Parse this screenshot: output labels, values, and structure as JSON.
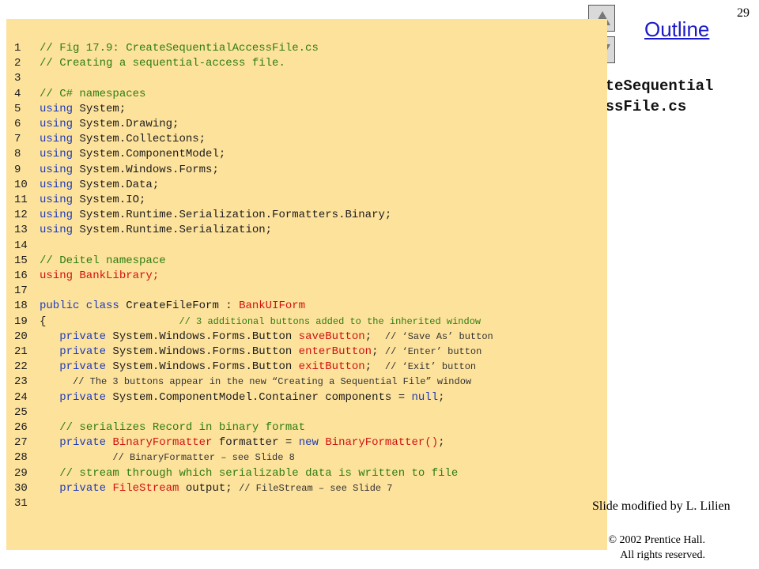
{
  "page_number": "29",
  "outline_title": "Outline",
  "file_label_line1": "CreateSequential",
  "file_label_line2": "AccessFile.cs",
  "slide_modified": "Slide modified by L. Lilien",
  "copyright_line1": "© 2002 Prentice Hall.",
  "copyright_line2": "All rights reserved.",
  "nav": {
    "up_icon": "triangle-up-icon",
    "down_icon": "triangle-down-icon"
  },
  "colors": {
    "panel_bg": "#fde29c",
    "comment": "#2e7d11",
    "keyword": "#1e3bb8",
    "highlight": "#d11111",
    "outline_link": "#1a1ac8"
  },
  "code_lines": [
    {
      "n": "1",
      "indent": "",
      "segments": [
        {
          "c": "cmt",
          "t": "// Fig 17.9: CreateSequentialAccessFile.cs"
        }
      ]
    },
    {
      "n": "2",
      "indent": "",
      "segments": [
        {
          "c": "cmt",
          "t": "// Creating a sequential-access file."
        }
      ]
    },
    {
      "n": "3",
      "indent": "",
      "segments": []
    },
    {
      "n": "4",
      "indent": "",
      "segments": [
        {
          "c": "cmt",
          "t": "// C# namespaces"
        }
      ]
    },
    {
      "n": "5",
      "indent": "",
      "segments": [
        {
          "c": "kw",
          "t": "using"
        },
        {
          "c": "",
          "t": " System;"
        }
      ]
    },
    {
      "n": "6",
      "indent": "",
      "segments": [
        {
          "c": "kw",
          "t": "using"
        },
        {
          "c": "",
          "t": " System.Drawing;"
        }
      ]
    },
    {
      "n": "7",
      "indent": "",
      "segments": [
        {
          "c": "kw",
          "t": "using"
        },
        {
          "c": "",
          "t": " System.Collections;"
        }
      ]
    },
    {
      "n": "8",
      "indent": "",
      "segments": [
        {
          "c": "kw",
          "t": "using"
        },
        {
          "c": "",
          "t": " System.ComponentModel;"
        }
      ]
    },
    {
      "n": "9",
      "indent": "",
      "segments": [
        {
          "c": "kw",
          "t": "using"
        },
        {
          "c": "",
          "t": " System.Windows.Forms;"
        }
      ]
    },
    {
      "n": "10",
      "indent": "",
      "segments": [
        {
          "c": "kw",
          "t": "using"
        },
        {
          "c": "",
          "t": " System.Data;"
        }
      ]
    },
    {
      "n": "11",
      "indent": "",
      "segments": [
        {
          "c": "kw",
          "t": "using"
        },
        {
          "c": "",
          "t": " System.IO;"
        }
      ]
    },
    {
      "n": "12",
      "indent": "",
      "segments": [
        {
          "c": "kw",
          "t": "using"
        },
        {
          "c": "",
          "t": " System.Runtime.Serialization.Formatters.Binary;"
        }
      ]
    },
    {
      "n": "13",
      "indent": "",
      "segments": [
        {
          "c": "kw",
          "t": "using"
        },
        {
          "c": "",
          "t": " System.Runtime.Serialization;"
        }
      ]
    },
    {
      "n": "14",
      "indent": "",
      "segments": []
    },
    {
      "n": "15",
      "indent": "",
      "segments": [
        {
          "c": "cmt",
          "t": "// Deitel namespace"
        }
      ]
    },
    {
      "n": "16",
      "indent": "",
      "segments": [
        {
          "c": "red",
          "t": "using BankLibrary;"
        }
      ]
    },
    {
      "n": "17",
      "indent": "",
      "segments": []
    },
    {
      "n": "18",
      "indent": "",
      "segments": [
        {
          "c": "kw",
          "t": "public class"
        },
        {
          "c": "",
          "t": " CreateFileForm : "
        },
        {
          "c": "red",
          "t": "BankUIForm"
        }
      ]
    },
    {
      "n": "19",
      "indent": "",
      "segments": [
        {
          "c": "",
          "t": "{                    "
        },
        {
          "c": "cmt-small",
          "t": "// 3 additional buttons added to the inherited window"
        }
      ]
    },
    {
      "n": "20",
      "indent": "   ",
      "segments": [
        {
          "c": "kw",
          "t": "private"
        },
        {
          "c": "",
          "t": " System.Windows.Forms.Button "
        },
        {
          "c": "red",
          "t": "saveButton"
        },
        {
          "c": "",
          "t": ";  "
        },
        {
          "c": "cmt-black",
          "t": "// ‘Save As’ button"
        }
      ]
    },
    {
      "n": "21",
      "indent": "   ",
      "segments": [
        {
          "c": "kw",
          "t": "private"
        },
        {
          "c": "",
          "t": " System.Windows.Forms.Button "
        },
        {
          "c": "red",
          "t": "enterButton"
        },
        {
          "c": "",
          "t": "; "
        },
        {
          "c": "cmt-black",
          "t": "// ‘Enter’ button"
        }
      ]
    },
    {
      "n": "22",
      "indent": "   ",
      "segments": [
        {
          "c": "kw",
          "t": "private"
        },
        {
          "c": "",
          "t": " System.Windows.Forms.Button "
        },
        {
          "c": "red",
          "t": "exitButton"
        },
        {
          "c": "",
          "t": ";  "
        },
        {
          "c": "cmt-black",
          "t": "// ‘Exit’ button"
        }
      ]
    },
    {
      "n": "23",
      "indent": "     ",
      "segments": [
        {
          "c": "cmt-black",
          "t": "// The 3 buttons appear in the new “Creating a Sequential File” window"
        }
      ]
    },
    {
      "n": "24",
      "indent": "   ",
      "segments": [
        {
          "c": "kw",
          "t": "private"
        },
        {
          "c": "",
          "t": " System.ComponentModel.Container components = "
        },
        {
          "c": "kw",
          "t": "null"
        },
        {
          "c": "",
          "t": ";"
        }
      ]
    },
    {
      "n": "25",
      "indent": "",
      "segments": []
    },
    {
      "n": "26",
      "indent": "   ",
      "segments": [
        {
          "c": "cmt",
          "t": "// serializes Record in binary format"
        }
      ]
    },
    {
      "n": "27",
      "indent": "   ",
      "segments": [
        {
          "c": "kw",
          "t": "private"
        },
        {
          "c": "",
          "t": " "
        },
        {
          "c": "red",
          "t": "BinaryFormatter"
        },
        {
          "c": "",
          "t": " formatter = "
        },
        {
          "c": "kw",
          "t": "new"
        },
        {
          "c": "",
          "t": " "
        },
        {
          "c": "red",
          "t": "BinaryFormatter()"
        },
        {
          "c": "",
          "t": ";"
        }
      ]
    },
    {
      "n": "28",
      "indent": "           ",
      "segments": [
        {
          "c": "cmt-black",
          "t": "// BinaryFormatter – see Slide 8"
        }
      ]
    },
    {
      "n": "29",
      "indent": "   ",
      "segments": [
        {
          "c": "cmt",
          "t": "// stream through which serializable data is written to file"
        }
      ]
    },
    {
      "n": "30",
      "indent": "   ",
      "segments": [
        {
          "c": "kw",
          "t": "private"
        },
        {
          "c": "",
          "t": " "
        },
        {
          "c": "red",
          "t": "FileStream"
        },
        {
          "c": "",
          "t": " output; "
        },
        {
          "c": "cmt-black",
          "t": "// FileStream – see Slide 7"
        }
      ]
    },
    {
      "n": "31",
      "indent": "",
      "segments": []
    }
  ]
}
